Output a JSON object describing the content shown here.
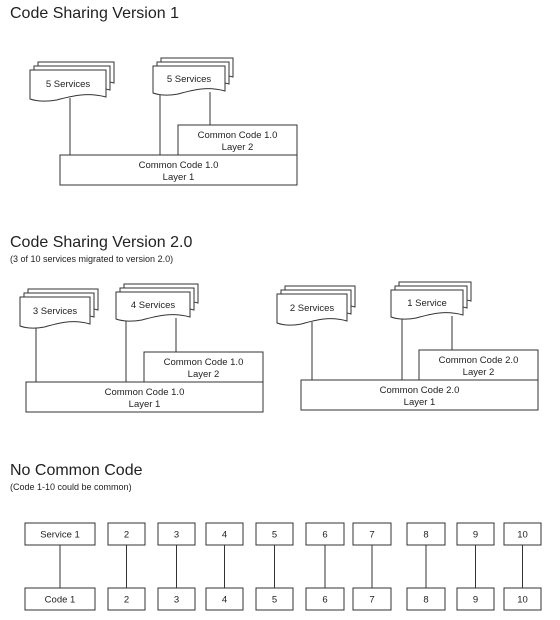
{
  "sections": [
    {
      "title": "Code Sharing Version 1",
      "subtitle": "",
      "groups": [
        {
          "service_stacks": [
            {
              "label": "5 Services",
              "connects_to": [
                "layer1"
              ]
            },
            {
              "label": "5 Services",
              "connects_to": [
                "layer1",
                "layer2"
              ]
            }
          ],
          "layer2": {
            "line1": "Common Code 1.0",
            "line2": "Layer 2"
          },
          "layer1": {
            "line1": "Common Code  1.0",
            "line2": "Layer 1"
          }
        }
      ]
    },
    {
      "title": "Code Sharing Version 2.0",
      "subtitle": "(3  of 10 services migrated to version 2.0)",
      "groups": [
        {
          "service_stacks": [
            {
              "label": "3 Services",
              "connects_to": [
                "layer1"
              ]
            },
            {
              "label": "4 Services",
              "connects_to": [
                "layer1",
                "layer2"
              ]
            }
          ],
          "layer2": {
            "line1": "Common Code 1.0",
            "line2": "Layer 2"
          },
          "layer1": {
            "line1": "Common Code  1.0",
            "line2": "Layer 1"
          }
        },
        {
          "service_stacks": [
            {
              "label": "2 Services",
              "connects_to": [
                "layer1"
              ]
            },
            {
              "label": "1 Service",
              "connects_to": [
                "layer1",
                "layer2"
              ]
            }
          ],
          "layer2": {
            "line1": "Common Code 2.0",
            "line2": "Layer 2"
          },
          "layer1": {
            "line1": "Common Code  2.0",
            "line2": "Layer 1"
          }
        }
      ]
    },
    {
      "title": "No Common Code",
      "subtitle": "(Code 1-10 could be common)",
      "pairs": [
        {
          "service": "Service 1",
          "code": "Code 1"
        },
        {
          "service": "2",
          "code": "2"
        },
        {
          "service": "3",
          "code": "3"
        },
        {
          "service": "4",
          "code": "4"
        },
        {
          "service": "5",
          "code": "5"
        },
        {
          "service": "6",
          "code": "6"
        },
        {
          "service": "7",
          "code": "7"
        },
        {
          "service": "8",
          "code": "8"
        },
        {
          "service": "9",
          "code": "9"
        },
        {
          "service": "10",
          "code": "10"
        }
      ]
    }
  ]
}
